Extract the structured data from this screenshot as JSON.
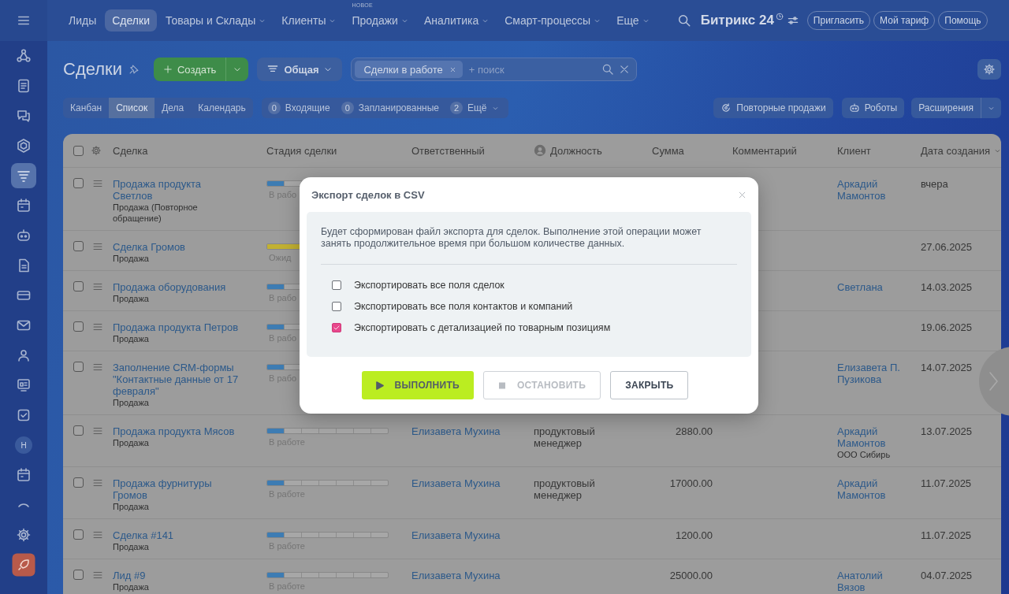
{
  "sidebar": {
    "items": [
      {
        "kind": "nodes",
        "selected": false
      },
      {
        "kind": "document",
        "selected": false
      },
      {
        "kind": "chat",
        "selected": false
      },
      {
        "kind": "hexagon",
        "selected": false
      },
      {
        "kind": "filter",
        "selected": true
      },
      {
        "kind": "calendar",
        "selected": false
      },
      {
        "kind": "robot",
        "selected": false
      },
      {
        "kind": "file",
        "selected": false
      },
      {
        "kind": "card",
        "selected": false
      },
      {
        "kind": "envelope",
        "selected": false
      },
      {
        "kind": "people",
        "selected": false
      },
      {
        "kind": "board",
        "selected": false
      },
      {
        "kind": "task",
        "selected": false
      },
      {
        "kind": "avatar",
        "initial": "Н",
        "selected": false
      },
      {
        "kind": "calendar",
        "selected": false
      },
      {
        "kind": "arc",
        "selected": false
      },
      {
        "kind": "gear",
        "selected": false
      },
      {
        "kind": "app",
        "selected": false
      }
    ]
  },
  "top_nav": {
    "items": [
      {
        "label": "Лиды",
        "selected": false,
        "dropdown": false
      },
      {
        "label": "Сделки",
        "selected": true,
        "dropdown": false
      },
      {
        "label": "Товары и Склады",
        "selected": false,
        "dropdown": true
      },
      {
        "label": "Клиенты",
        "selected": false,
        "dropdown": true
      },
      {
        "label": "Продажи",
        "badge": "НОВОЕ",
        "selected": false,
        "dropdown": true
      },
      {
        "label": "Аналитика",
        "selected": false,
        "dropdown": true
      },
      {
        "label": "Смарт-процессы",
        "selected": false,
        "dropdown": true
      },
      {
        "label": "Еще",
        "selected": false,
        "dropdown": true
      }
    ],
    "logo": "Битрикс 24",
    "buttons": [
      "Пригласить",
      "Мой тариф",
      "Помощь"
    ]
  },
  "page": {
    "title": "Сделки",
    "create_button": "Создать",
    "preset": "Общая",
    "search": {
      "tags": [
        "Сделки в работе"
      ],
      "placeholder": "+ поиск"
    }
  },
  "view_tabs": [
    {
      "label": "Канбан",
      "selected": false
    },
    {
      "label": "Список",
      "selected": true
    },
    {
      "label": "Дела",
      "selected": false
    },
    {
      "label": "Календарь",
      "selected": false
    }
  ],
  "counters": [
    {
      "count": "0",
      "label": "Входящие",
      "dropdown": false
    },
    {
      "count": "0",
      "label": "Запланированные",
      "dropdown": false
    },
    {
      "count": "2",
      "label": "Ещё",
      "dropdown": true
    }
  ],
  "tools": [
    {
      "kind": "repeat",
      "label": "Повторные продажи"
    },
    {
      "kind": "robot",
      "label": "Роботы"
    },
    {
      "kind": "split",
      "label": "Расширения"
    }
  ],
  "table": {
    "select_all": false,
    "columns": [
      "Сделка",
      "Стадия сделки",
      "Ответственный",
      "Должность",
      "Сумма",
      "Комментарий",
      "Клиент",
      "Дата создания"
    ],
    "rows": [
      {
        "checked": false,
        "title": "Продажа продукта Светлов",
        "subtitle": "Продажа (Повторное обращение)",
        "stage": {
          "label": "В рабо",
          "level": 0.14,
          "color": "#3d7cb3"
        },
        "client": "Аркадий Мамонтов",
        "date": "вчера"
      },
      {
        "checked": false,
        "title": "Сделка Громов",
        "subtitle": "Продажа",
        "stage": {
          "label": "Ожид",
          "level": 0.29,
          "color": "#c2b132"
        },
        "date": "27.06.2025"
      },
      {
        "checked": false,
        "title": "Продажа оборудования",
        "subtitle": "Продажа",
        "stage": {
          "label": "В рабо",
          "level": 0.14,
          "color": "#3d7cb3"
        },
        "client": "Светлана",
        "date": "14.03.2025"
      },
      {
        "checked": false,
        "title": "Продажа продукта Петров",
        "subtitle": "Продажа",
        "stage": {
          "label": "В рабо",
          "level": 0.14,
          "color": "#3d7cb3"
        },
        "date": "19.06.2025"
      },
      {
        "checked": false,
        "title": "Заполнение CRM-формы \"Контактные данные от 17 февраля\"",
        "subtitle": "Продажа",
        "stage": {
          "label": "В рабо",
          "level": 0.14,
          "color": "#3d7cb3"
        },
        "client": "Елизавета П. Пузикова",
        "date": "14.07.2025"
      },
      {
        "checked": false,
        "title": "Продажа продукта Мясов",
        "subtitle": "Продажа",
        "stage": {
          "label": "В работе",
          "level": 0.14,
          "color": "#3d7cb3"
        },
        "responsible": "Елизавета Мухина",
        "position": "продуктовый менеджер",
        "sum": "2880.00",
        "client": "Аркадий Мамонтов",
        "client_company": "ООО Сибирь",
        "date": "13.07.2025"
      },
      {
        "checked": false,
        "title": "Продажа фурнитуры Громов",
        "subtitle": "Продажа",
        "stage": {
          "label": "В работе",
          "level": 0.14,
          "color": "#3d7cb3"
        },
        "responsible": "Елизавета Мухина",
        "position": "продуктовый менеджер",
        "sum": "17000.00",
        "client": "Аркадий Мамонтов",
        "date": "11.07.2025"
      },
      {
        "checked": false,
        "title": "Сделка #141",
        "subtitle": "Продажа",
        "stage": {
          "label": "В работе",
          "level": 0.14,
          "color": "#3d7cb3"
        },
        "responsible": "Елизавета Мухина",
        "sum": "1200.00",
        "date": "11.07.2025"
      },
      {
        "checked": false,
        "title": "Лид #9",
        "subtitle": "Продажа",
        "stage": {
          "label": "В работе",
          "level": 0.14,
          "color": "#3d7cb3"
        },
        "responsible": "Елизавета Мухина",
        "sum": "25000.00",
        "client": "Анатолий Вязов",
        "date": "04.07.2025"
      }
    ]
  },
  "dialog": {
    "title": "Экспорт сделок в CSV",
    "message": "Будет сформирован файл экспорта для сделок. Выполнение этой операции может занять продолжительное время при большом количестве данных.",
    "options": [
      {
        "label": "Экспортировать все поля сделок",
        "checked": false
      },
      {
        "label": "Экспортировать все поля контактов и компаний",
        "checked": false
      },
      {
        "label": "Экспортировать с детализацией по товарным позициям",
        "checked": true
      }
    ],
    "buttons": [
      {
        "kind": "run",
        "label": "ВЫПОЛНИТЬ",
        "disabled": false
      },
      {
        "kind": "stop",
        "label": "ОСТАНОВИТЬ",
        "disabled": true
      },
      {
        "kind": "close",
        "label": "ЗАКРЫТЬ",
        "disabled": false
      }
    ]
  }
}
